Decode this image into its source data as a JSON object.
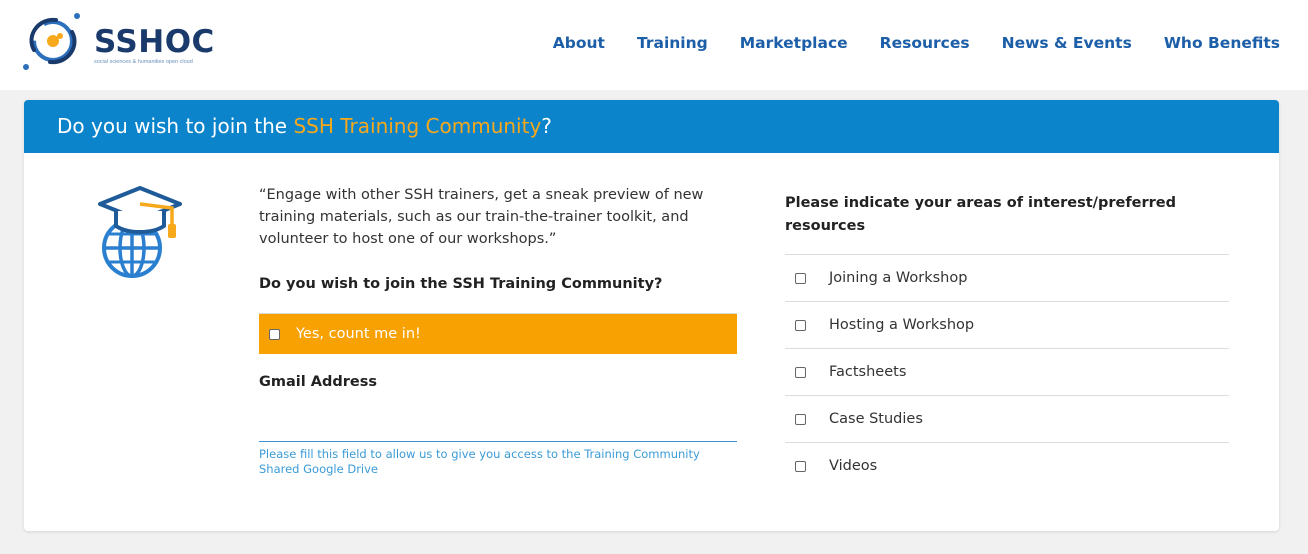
{
  "brand": {
    "name": "SSHOC",
    "tagline": "social sciences & humanities open cloud",
    "colors": {
      "primary": "#1a3a6c",
      "accent": "#f7a81b",
      "header_blue": "#0b84cc",
      "orange_bar": "#f8a102"
    }
  },
  "nav": {
    "items": [
      {
        "label": "About"
      },
      {
        "label": "Training"
      },
      {
        "label": "Marketplace"
      },
      {
        "label": "Resources"
      },
      {
        "label": "News & Events"
      },
      {
        "label": "Who Benefits"
      }
    ]
  },
  "card": {
    "title_prefix": "Do you wish to join the ",
    "title_highlight": "SSH Training Community",
    "title_suffix": "?",
    "icon": "graduation-globe-icon",
    "quote": "“Engage with other SSH trainers, get a sneak preview of new training materials, such as our train-the-trainer toolkit, and volunteer to host one of our workshops.”",
    "join_question": "Do you wish to join the SSH Training Community?",
    "join_option": {
      "label": "Yes, count me in!",
      "checked": false
    },
    "gmail": {
      "label": "Gmail Address",
      "value": "",
      "help": "Please fill this field to allow us to give you access to the Training Community Shared Google Drive"
    },
    "interests": {
      "label": "Please indicate your areas of interest/preferred resources",
      "options": [
        {
          "label": "Joining a Workshop",
          "checked": false
        },
        {
          "label": "Hosting a Workshop",
          "checked": false
        },
        {
          "label": "Factsheets",
          "checked": false
        },
        {
          "label": "Case Studies",
          "checked": false
        },
        {
          "label": "Videos",
          "checked": false
        }
      ]
    }
  }
}
